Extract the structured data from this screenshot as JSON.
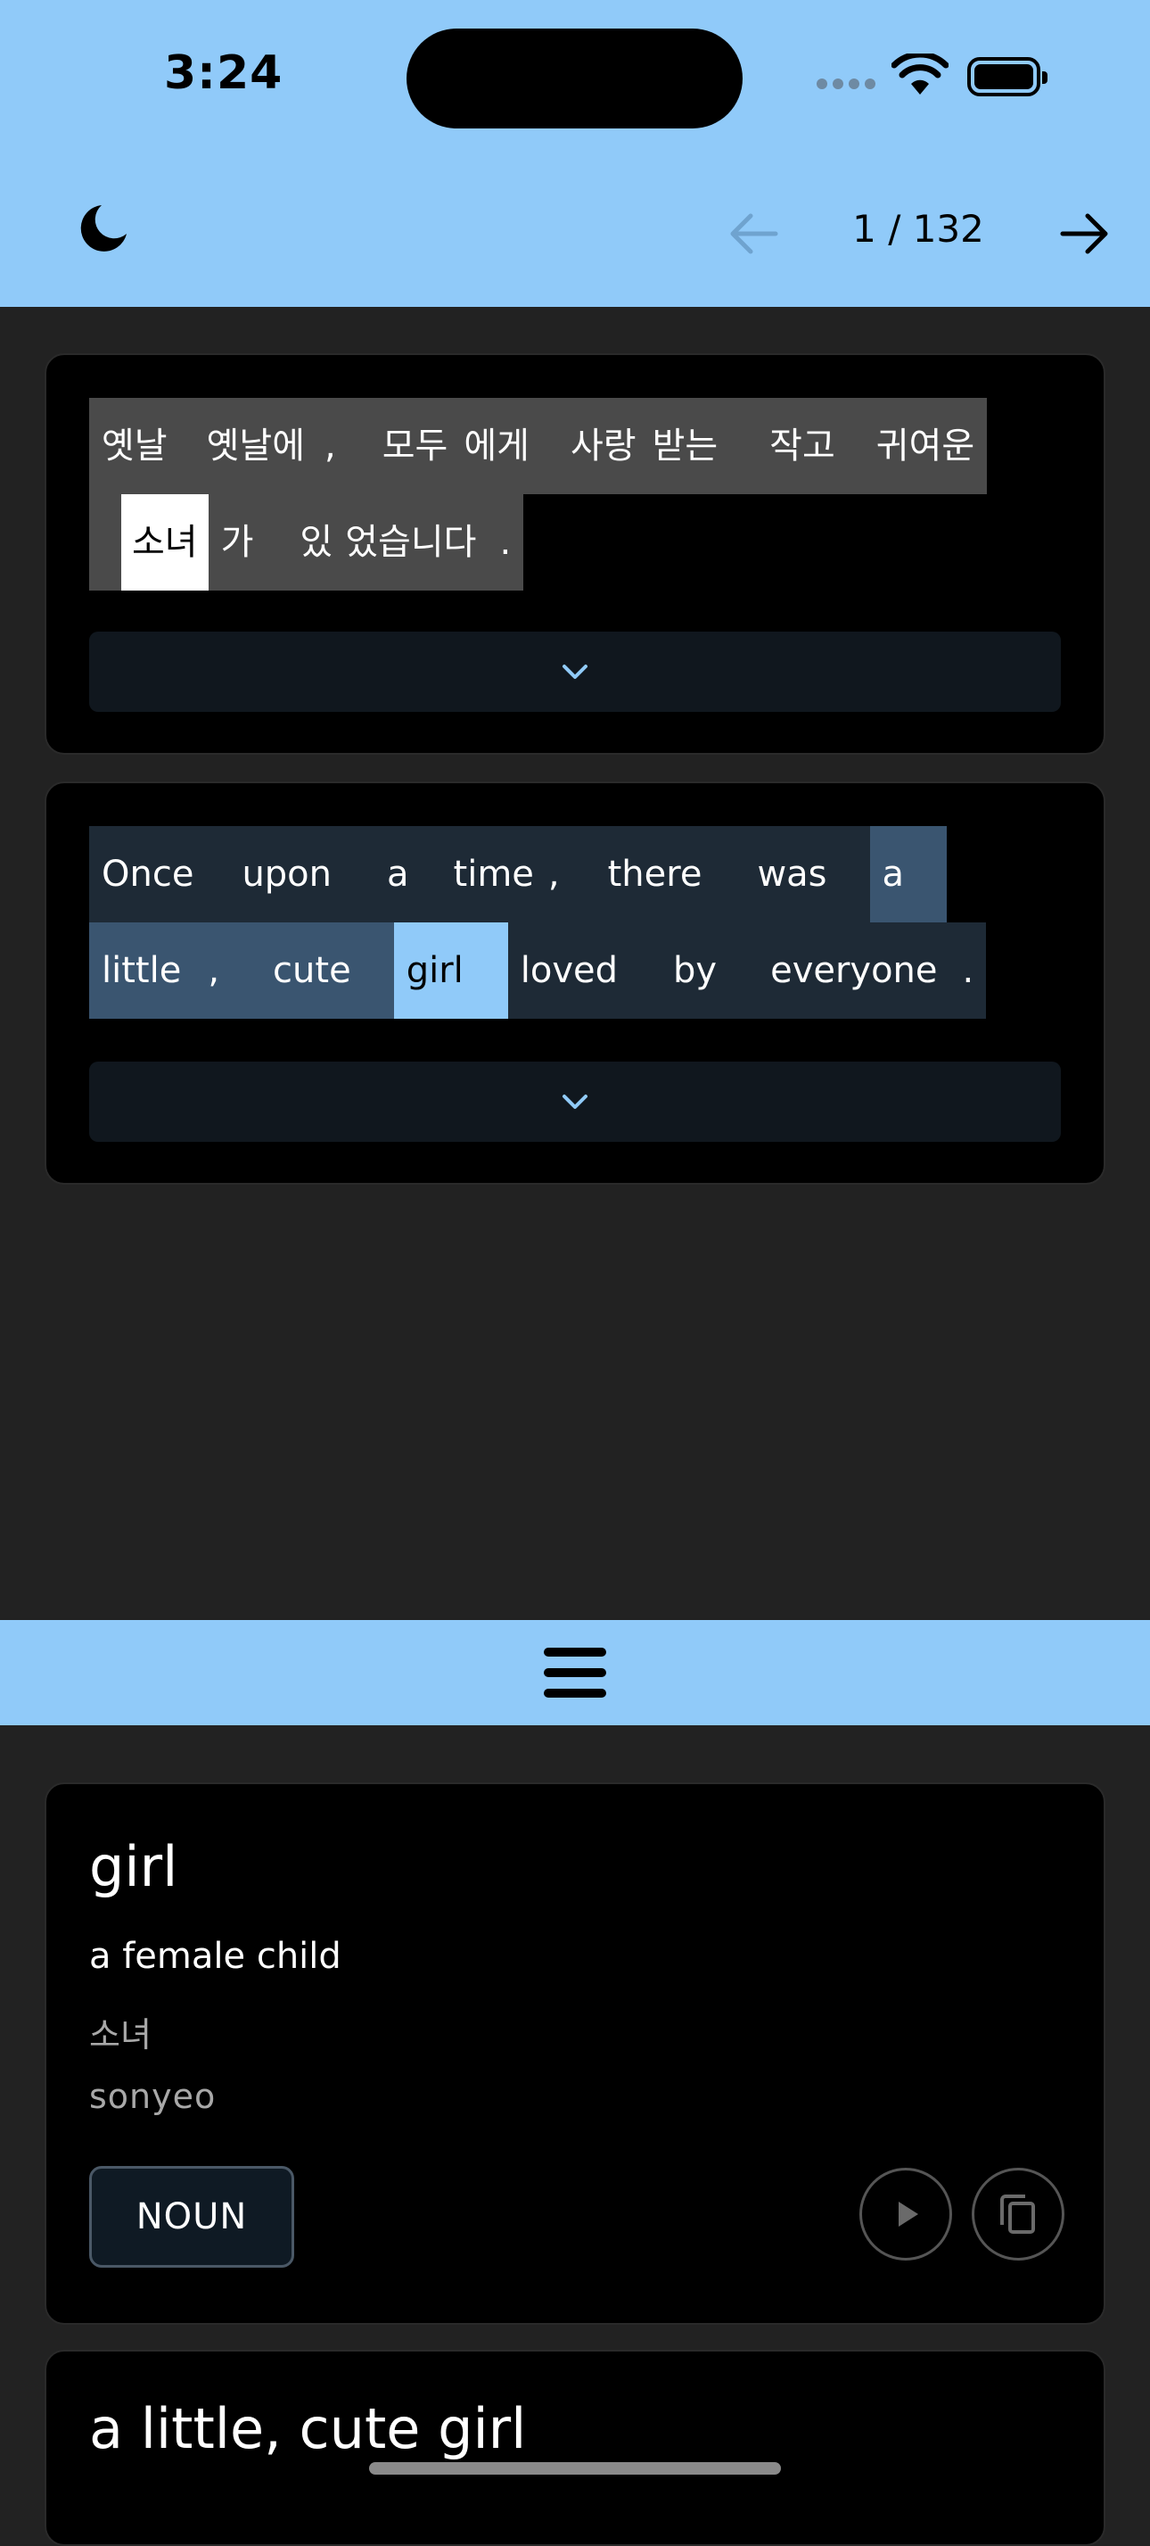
{
  "status_bar": {
    "time": "3:24"
  },
  "top_bar": {
    "theme_icon": "moon-icon",
    "prev_icon": "arrow-left-icon",
    "next_icon": "arrow-right-icon",
    "page_indicator": "1 / 132"
  },
  "source_sentence": {
    "lines": [
      [
        "옛날",
        "옛날에",
        ",",
        "모두",
        "에게",
        "사랑",
        "받는",
        "작고",
        "귀여운"
      ],
      [
        "소녀",
        "가",
        "있",
        "었습니다",
        "."
      ]
    ],
    "selected_token": "소녀",
    "expand_icon": "chevron-down-icon"
  },
  "translation_sentence": {
    "lines": [
      [
        "Once",
        "upon",
        "a",
        "time",
        ",",
        "there",
        "was",
        "a"
      ],
      [
        "little",
        ",",
        "cute",
        "girl",
        "loved",
        "by",
        "everyone",
        "."
      ]
    ],
    "selected_token": "girl",
    "highlighted_phrase": "a little , cute",
    "expand_icon": "chevron-down-icon"
  },
  "divider": {
    "icon": "menu-icon"
  },
  "definitions": [
    {
      "word": "girl",
      "gloss": "a female child",
      "korean": "소녀",
      "romanization": "sonyeo",
      "part_of_speech": "NOUN",
      "play_icon": "play-icon",
      "copy_icon": "copy-icon"
    },
    {
      "word": "a little, cute girl"
    }
  ],
  "colors": {
    "accent": "#90caf9",
    "background": "#222222",
    "card": "#000000",
    "korean_token_bg": "#4a4a4a",
    "english_token_bg": "#1e2a36",
    "phrase_highlight": "#3a5570"
  }
}
